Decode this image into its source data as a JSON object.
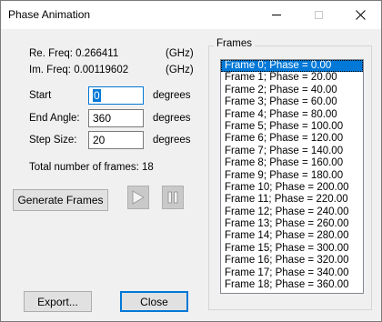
{
  "window": {
    "title": "Phase Animation"
  },
  "freq": {
    "re_label": "Re. Freq: 0.266411",
    "re_unit": "(GHz)",
    "im_label": "Im. Freq: 0.00119602",
    "im_unit": "(GHz)"
  },
  "fields": {
    "start_label": "Start",
    "start_value": "0",
    "start_unit": "degrees",
    "end_label": "End Angle:",
    "end_value": "360",
    "end_unit": "degrees",
    "step_label": "Step Size:",
    "step_value": "20",
    "step_unit": "degrees"
  },
  "total_frames": "Total number of frames: 18",
  "buttons": {
    "generate": "Generate Frames",
    "export": "Export...",
    "close": "Close"
  },
  "frames": {
    "group_title": "Frames",
    "items": [
      "Frame 0; Phase = 0.00",
      "Frame 1; Phase = 20.00",
      "Frame 2; Phase = 40.00",
      "Frame 3; Phase = 60.00",
      "Frame 4; Phase = 80.00",
      "Frame 5; Phase = 100.00",
      "Frame 6; Phase = 120.00",
      "Frame 7; Phase = 140.00",
      "Frame 8; Phase = 160.00",
      "Frame 9; Phase = 180.00",
      "Frame 10; Phase = 200.00",
      "Frame 11; Phase = 220.00",
      "Frame 12; Phase = 240.00",
      "Frame 13; Phase = 260.00",
      "Frame 14; Phase = 280.00",
      "Frame 15; Phase = 300.00",
      "Frame 16; Phase = 320.00",
      "Frame 17; Phase = 340.00",
      "Frame 18; Phase = 360.00"
    ]
  },
  "icons": {
    "play": "play-icon",
    "pause": "pause-icon",
    "minimize": "minimize-icon",
    "maximize": "maximize-icon",
    "close": "close-icon"
  }
}
